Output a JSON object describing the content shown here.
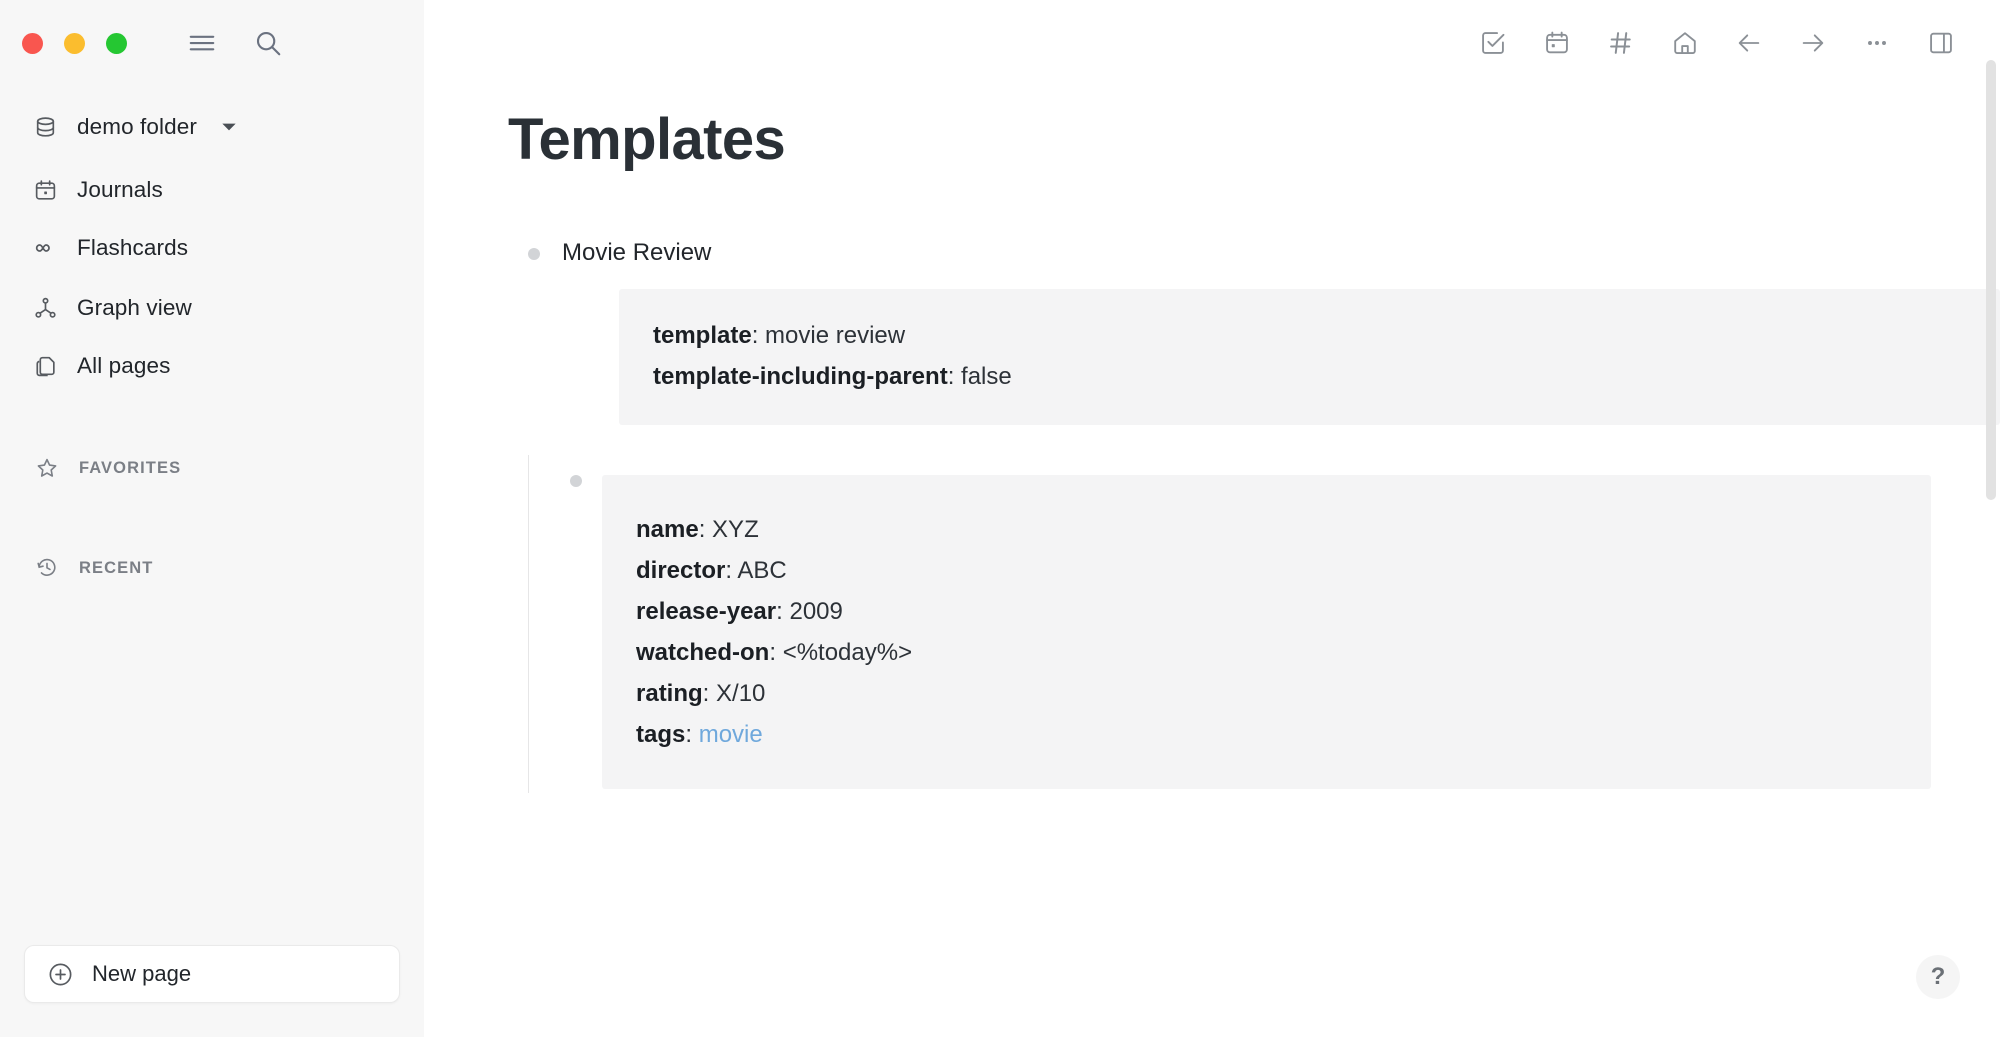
{
  "window": {
    "controls": [
      {
        "name": "close",
        "color": "#f9564f"
      },
      {
        "name": "minimize",
        "color": "#fbbd2e"
      },
      {
        "name": "maximize",
        "color": "#25c732"
      }
    ]
  },
  "sidebar": {
    "toggle_icon": "hamburger-icon",
    "search_icon": "search-icon",
    "graph_selector": {
      "icon": "database-icon",
      "label": "demo folder",
      "chevron": "chevron-down-icon"
    },
    "nav_items": [
      {
        "icon": "calendar-icon",
        "label": "Journals"
      },
      {
        "icon": "infinity-icon",
        "label": "Flashcards"
      },
      {
        "icon": "graph-icon",
        "label": "Graph view"
      },
      {
        "icon": "pages-icon",
        "label": "All pages"
      }
    ],
    "sections": [
      {
        "icon": "star-icon",
        "label": "FAVORITES"
      },
      {
        "icon": "history-icon",
        "label": "RECENT"
      }
    ],
    "new_page": {
      "icon": "plus-circle-icon",
      "label": "New page"
    }
  },
  "toolbar": {
    "buttons": [
      {
        "icon": "checkbox-check-icon",
        "label": "Tasks"
      },
      {
        "icon": "calendar-icon",
        "label": "Journal"
      },
      {
        "icon": "hash-icon",
        "label": "Tags"
      },
      {
        "icon": "home-icon",
        "label": "Home"
      },
      {
        "icon": "arrow-left-icon",
        "label": "Back"
      },
      {
        "icon": "arrow-right-icon",
        "label": "Forward"
      },
      {
        "icon": "ellipsis-icon",
        "label": "More"
      },
      {
        "icon": "right-sidebar-icon",
        "label": "Toggle right sidebar"
      }
    ]
  },
  "page": {
    "title": "Templates",
    "blocks": [
      {
        "text": "Movie Review",
        "properties": [
          {
            "key": "template",
            "sep": ": ",
            "value": "movie review"
          },
          {
            "key": "template-including-parent",
            "sep": ": ",
            "value": "false"
          }
        ],
        "child": {
          "properties": [
            {
              "key": "name",
              "sep": ": ",
              "value": "XYZ",
              "link": false
            },
            {
              "key": "director",
              "sep": ": ",
              "value": "ABC",
              "link": false
            },
            {
              "key": "release-year",
              "sep": ": ",
              "value": "2009",
              "link": false
            },
            {
              "key": "watched-on",
              "sep": ": ",
              "value": "<%today%>",
              "link": false
            },
            {
              "key": "rating",
              "sep": ": ",
              "value": "X/10",
              "link": false
            },
            {
              "key": "tags",
              "sep": ": ",
              "value": "movie",
              "link": true
            }
          ]
        }
      }
    ]
  },
  "help": {
    "label": "?"
  },
  "colors": {
    "sidebar_bg": "#f7f7f7",
    "prop_card_bg": "#f4f4f5",
    "tag_link": "#6fa8dc",
    "text": "#22262b",
    "muted": "#7b7f86"
  }
}
